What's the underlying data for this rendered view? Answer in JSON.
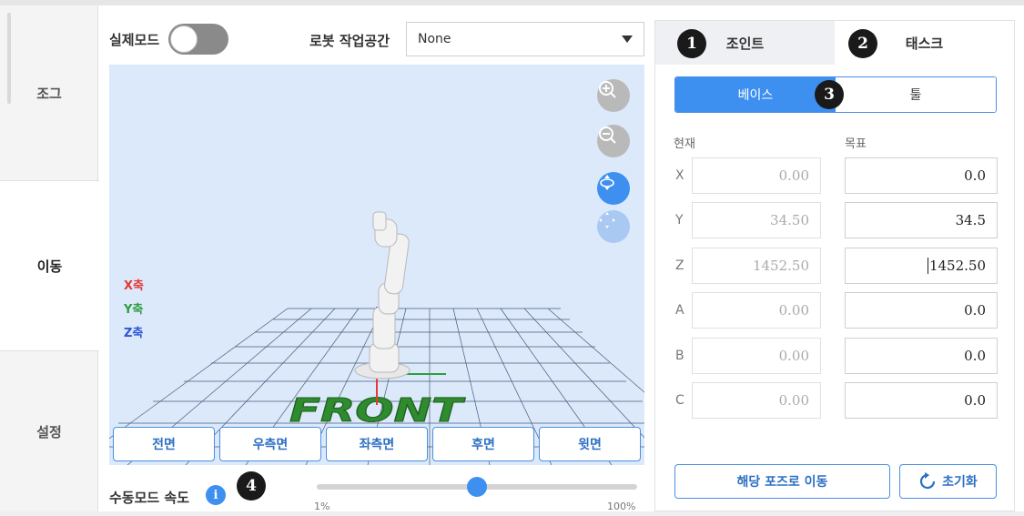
{
  "sidebar": {
    "items": [
      {
        "label": "조그",
        "active": false
      },
      {
        "label": "이동",
        "active": true
      },
      {
        "label": "설정",
        "active": false
      }
    ]
  },
  "header": {
    "real_mode_label": "실제모드",
    "real_mode_on": false,
    "workspace_label": "로봇 작업공간",
    "workspace_value": "None"
  },
  "viewport": {
    "axis_legend": {
      "x": "X축",
      "y": "Y축",
      "z": "Z축"
    },
    "axis_colors": {
      "x": "#e53935",
      "y": "#2e9e3e",
      "z": "#2b55d6"
    },
    "floor_text": "FRONT",
    "floor_text_color": "#2e8b2e",
    "tools": [
      "zoom-in-icon",
      "zoom-out-icon",
      "rotate-view-icon",
      "pan-view-icon"
    ],
    "view_buttons": [
      "전면",
      "우측면",
      "좌측면",
      "후면",
      "윗면"
    ]
  },
  "speed": {
    "label": "수동모드 속도",
    "info_icon": "i",
    "min_label": "1%",
    "max_label": "100%",
    "value_fraction": 0.5
  },
  "markers": [
    "1",
    "2",
    "3",
    "4"
  ],
  "panel": {
    "tabs": [
      {
        "label": "조인트",
        "active": false
      },
      {
        "label": "태스크",
        "active": true
      }
    ],
    "frame_segment": [
      {
        "label": "베이스",
        "active": true
      },
      {
        "label": "툴",
        "active": false
      }
    ],
    "current_header": "현재",
    "target_header": "목표",
    "rows": [
      {
        "axis": "X",
        "current": "0.00",
        "target": "0.0"
      },
      {
        "axis": "Y",
        "current": "34.50",
        "target": "34.5"
      },
      {
        "axis": "Z",
        "current": "1452.50",
        "target": "1452.50"
      },
      {
        "axis": "A",
        "current": "0.00",
        "target": "0.0"
      },
      {
        "axis": "B",
        "current": "0.00",
        "target": "0.0"
      },
      {
        "axis": "C",
        "current": "0.00",
        "target": "0.0"
      }
    ],
    "move_button": "해당 포즈로 이동",
    "reset_button": "초기화"
  },
  "colors": {
    "accent": "#3d8ff0",
    "viewport_bg": "#dbe9fb"
  }
}
